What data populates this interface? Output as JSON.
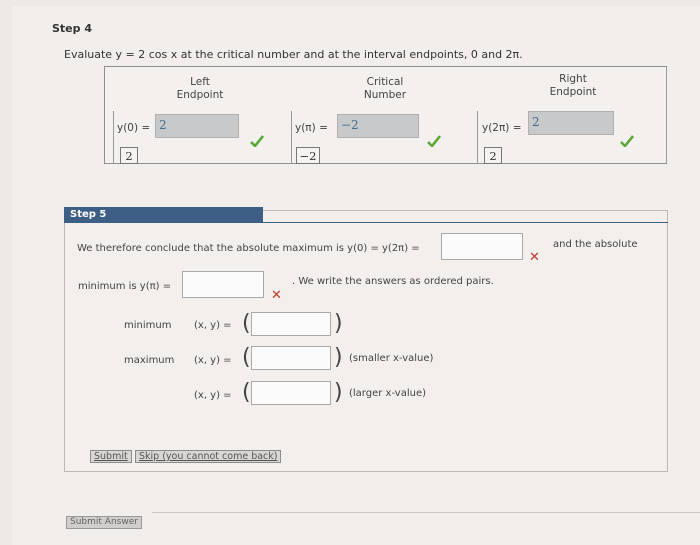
{
  "step4": {
    "title": "Step 4",
    "question": "Evaluate y = 2 cos x at the critical number and at the interval endpoints, 0 and 2π.",
    "headers": {
      "left": [
        "Left",
        "Endpoint"
      ],
      "critical": [
        "Critical",
        "Number"
      ],
      "right": [
        "Right",
        "Endpoint"
      ]
    },
    "left_eq": "y(0) =",
    "left_answer": "2",
    "left_value": "2",
    "crit_eq": "y(π) =",
    "crit_answer": "−2",
    "crit_value": "−2",
    "right_eq": "y(2π) =",
    "right_answer": "2",
    "right_value": "2"
  },
  "step5": {
    "tab_label": "Step 5",
    "conclude_text": "We therefore conclude that the absolute maximum is y(0) = y(2π) =",
    "and_absolute": "and the absolute",
    "minimum_text": "minimum is y(π) =",
    "ordered_pairs_text": ". We write the answers as ordered pairs.",
    "minimum_label": "minimum",
    "maximum_label": "maximum",
    "xy_eq": "(x, y) =",
    "smaller_note": "(smaller x-value)",
    "larger_note": "(larger x-value)",
    "submit_label": "Submit",
    "skip_label": "Skip (you cannot come back)"
  },
  "footer": {
    "submit_answer_label": "Submit Answer"
  },
  "colors": {
    "check": "#5aa83a",
    "cross": "#c0392b",
    "tab": "#3d5f86"
  }
}
